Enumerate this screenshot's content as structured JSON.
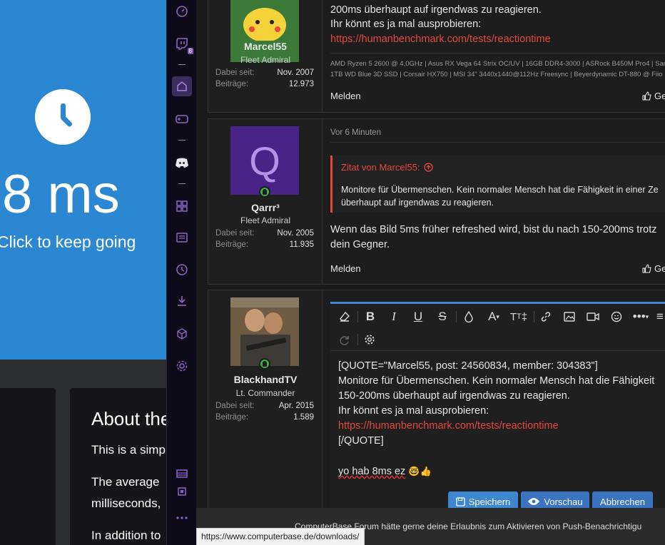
{
  "benchmark": {
    "result": "8 ms",
    "hint": "Click to keep going",
    "about_title": "About the",
    "paragraphs": [
      "This is a simp",
      "The average",
      "milliseconds,",
      "In addition to"
    ],
    "colors": {
      "primary": "#2b87d1"
    }
  },
  "sidebar": {
    "items": [
      {
        "icon": "speedometer-icon"
      },
      {
        "icon": "twitch-icon",
        "badge": "8"
      },
      {
        "icon": "home-icon"
      },
      {
        "icon": "gamepad-icon"
      },
      {
        "icon": "discord-icon"
      },
      {
        "icon": "grid-icon"
      },
      {
        "icon": "news-icon"
      },
      {
        "icon": "history-icon"
      },
      {
        "icon": "download-icon"
      },
      {
        "icon": "cube-icon"
      },
      {
        "icon": "settings-icon"
      },
      {
        "icon": "memory-icon"
      },
      {
        "icon": "cpu-icon"
      },
      {
        "icon": "more-icon"
      }
    ]
  },
  "posts": [
    {
      "user": {
        "name": "Marcel55",
        "rank": "Fleet Admiral",
        "joined_label": "Dabei seit:",
        "joined": "Nov. 2007",
        "posts_label": "Beiträge:",
        "posts": "12.973"
      },
      "lines": [
        "200ms überhaupt auf irgendwas zu reagieren.",
        "Ihr könnt es ja mal ausprobieren:"
      ],
      "link": "https://humanbenchmark.com/tests/reactiontime",
      "signature": [
        "AMD Ryzen 5 2600 @ 4,0GHz | Asus RX Vega 64 Strix OC/UV | 16GB DDR4-3000 | ASRock B450M Pro4 | Sar",
        "1TB WD Blue 3D SSD | Corsair HX750 | MSI 34\" 3440x1440@112Hz Freesync | Beyerdynamic DT-880 @ Fiio"
      ],
      "report": "Melden",
      "like": "Gefäll"
    },
    {
      "user": {
        "name": "Qarrr³",
        "initial": "Q",
        "rank": "Fleet Admiral",
        "joined_label": "Dabei seit:",
        "joined": "Nov. 2005",
        "posts_label": "Beiträge:",
        "posts": "11.935"
      },
      "time": "Vor 6 Minuten",
      "quote_head": "Zitat von Marcel55:",
      "quote_lines": [
        "Monitore für Übermenschen. Kein normaler Mensch hat die Fähigkeit in einer Ze",
        "überhaupt auf irgendwas zu reagieren."
      ],
      "lines": [
        "Wenn das Bild 5ms früher refreshed wird, bist du nach 150-200ms trotz",
        "dein Gegner."
      ],
      "report": "Melden",
      "like": "Gefäll"
    },
    {
      "user": {
        "name": "BlackhandTV",
        "rank": "Lt. Commander",
        "joined_label": "Dabei seit:",
        "joined": "Apr. 2015",
        "posts_label": "Beiträge:",
        "posts": "1.589"
      }
    }
  ],
  "editor": {
    "lines": [
      "[QUOTE=\"Marcel55, post: 24560834, member: 304383\"]",
      "Monitore für Übermenschen. Kein normaler Mensch hat die Fähigkeit",
      "150-200ms überhaupt auf irgendwas zu reagieren.",
      "Ihr könnt es ja mal ausprobieren:",
      "https://humanbenchmark.com/tests/reactiontime",
      "[/QUOTE]",
      "",
      "yo hab 8ms ez"
    ],
    "emoji": "🤓👍",
    "save": "Speichern",
    "preview": "Vorschau",
    "cancel": "Abbrechen"
  },
  "notification": "ComputerBase Forum hätte gerne deine Erlaubnis zum Aktivieren von Push-Benachrichtigu",
  "status_url": "https://www.computerbase.de/downloads/"
}
